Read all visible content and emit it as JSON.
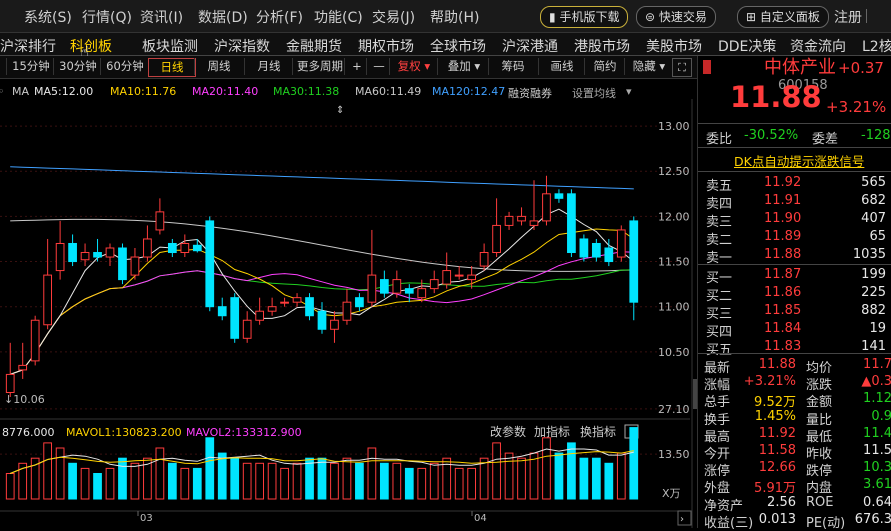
{
  "menubar": {
    "items": [
      "系统(S)",
      "行情(Q)",
      "资讯(I)",
      "数据(D)",
      "分析(F)",
      "功能(C)",
      "交易(J)",
      "帮助(H)"
    ],
    "mobile_download": "手机版下载",
    "quick_trade": "快速交易",
    "custom_panel": "自定义面板",
    "register": "注册"
  },
  "tabs": [
    "沪深排行",
    "科创板",
    "板块监测",
    "沪深指数",
    "金融期货",
    "期权市场",
    "全球市场",
    "沪深港通",
    "港股市场",
    "美股市场",
    "DDE决策",
    "资金流向",
    "L2核"
  ],
  "active_tab": 1,
  "periods": [
    "15分钟",
    "30分钟",
    "60分钟",
    "日线",
    "周线",
    "月线",
    "更多周期",
    "+",
    "—",
    "复权",
    "叠加",
    "筹码",
    "画线",
    "简约",
    "隐藏"
  ],
  "active_period": 3,
  "ma_line": {
    "prefix": "MA",
    "ma5": "MA5:12.00",
    "ma10": "MA10:11.76",
    "ma20": "MA20:11.40",
    "ma30": "MA30:11.38",
    "ma60": "MA60:11.49",
    "ma120": "MA120:12.47",
    "rzrq": "融资融券",
    "settings": "设置均线"
  },
  "price_axis": [
    "13.00",
    "12.50",
    "12.00",
    "11.50",
    "11.00",
    "10.50"
  ],
  "low_label": "10.06",
  "vol_line": {
    "vol": "8776.000",
    "mavol1": "MAVOL1:130823.200",
    "mavol2": "MAVOL2:133312.900",
    "change_params": "改参数",
    "add_indicator": "加指标",
    "switch_indicator": "换指标"
  },
  "vol_axis": [
    "27.10",
    "13.50",
    "X万"
  ],
  "date_labels": [
    "03",
    "04"
  ],
  "colors": {
    "up": "#ff3c3c",
    "down": "#00e5ff",
    "ma5": "#e8e8e8",
    "ma10": "#ffd200",
    "ma20": "#ff40ff",
    "ma30": "#20d020",
    "ma60": "#c8c8c8",
    "ma120": "#40a0ff"
  },
  "chart_data": {
    "type": "candlestick",
    "candles": [
      [
        10.05,
        10.25,
        10.6,
        10.0
      ],
      [
        10.3,
        10.35,
        10.6,
        10.2
      ],
      [
        10.4,
        10.85,
        10.9,
        10.35
      ],
      [
        10.8,
        11.35,
        11.75,
        10.75
      ],
      [
        11.4,
        11.7,
        11.95,
        11.3
      ],
      [
        11.7,
        11.5,
        11.8,
        11.45
      ],
      [
        11.52,
        11.6,
        11.7,
        11.45
      ],
      [
        11.6,
        11.55,
        11.75,
        11.5
      ],
      [
        11.55,
        11.65,
        11.7,
        11.45
      ],
      [
        11.65,
        11.3,
        11.7,
        11.25
      ],
      [
        11.35,
        11.55,
        11.65,
        11.3
      ],
      [
        11.55,
        11.75,
        11.9,
        11.5
      ],
      [
        11.85,
        12.05,
        12.2,
        11.8
      ],
      [
        11.7,
        11.6,
        11.75,
        11.55
      ],
      [
        11.6,
        11.7,
        11.8,
        11.55
      ],
      [
        11.68,
        11.62,
        11.75,
        11.6
      ],
      [
        11.95,
        11.0,
        12.0,
        10.95
      ],
      [
        11.0,
        10.9,
        11.1,
        10.85
      ],
      [
        11.1,
        10.65,
        11.15,
        10.6
      ],
      [
        10.65,
        10.85,
        10.95,
        10.6
      ],
      [
        10.85,
        10.95,
        11.1,
        10.8
      ],
      [
        10.95,
        11.0,
        11.1,
        10.9
      ],
      [
        11.05,
        11.05,
        11.1,
        11.0
      ],
      [
        11.05,
        11.1,
        11.15,
        11.0
      ],
      [
        11.1,
        10.9,
        11.15,
        10.85
      ],
      [
        10.95,
        10.75,
        11.05,
        10.7
      ],
      [
        10.75,
        10.85,
        10.95,
        10.6
      ],
      [
        10.85,
        11.05,
        11.2,
        10.8
      ],
      [
        11.1,
        11.0,
        11.15,
        10.95
      ],
      [
        11.05,
        11.35,
        11.85,
        11.0
      ],
      [
        11.3,
        11.15,
        11.4,
        11.1
      ],
      [
        11.15,
        11.3,
        11.4,
        11.1
      ],
      [
        11.2,
        11.15,
        11.25,
        11.05
      ],
      [
        11.1,
        11.2,
        11.3,
        11.05
      ],
      [
        11.2,
        11.3,
        11.4,
        11.15
      ],
      [
        11.25,
        11.4,
        11.6,
        11.2
      ],
      [
        11.35,
        11.35,
        11.45,
        11.3
      ],
      [
        11.3,
        11.35,
        11.45,
        11.2
      ],
      [
        11.45,
        11.6,
        11.7,
        11.4
      ],
      [
        11.6,
        11.9,
        12.2,
        11.55
      ],
      [
        11.9,
        12.0,
        12.05,
        11.85
      ],
      [
        11.95,
        12.0,
        12.1,
        11.9
      ],
      [
        11.9,
        11.95,
        12.4,
        11.85
      ],
      [
        11.95,
        12.25,
        12.45,
        11.9
      ],
      [
        12.25,
        12.2,
        12.3,
        12.15
      ],
      [
        12.25,
        11.6,
        12.3,
        11.55
      ],
      [
        11.75,
        11.55,
        11.8,
        11.5
      ],
      [
        11.7,
        11.55,
        11.75,
        11.5
      ],
      [
        11.65,
        11.5,
        11.75,
        11.45
      ],
      [
        11.55,
        11.85,
        11.9,
        11.5
      ],
      [
        11.95,
        11.05,
        12.0,
        10.85
      ]
    ],
    "volumes": [
      5,
      7,
      8,
      11,
      10,
      7,
      6,
      5,
      6,
      8,
      7,
      8,
      10,
      7,
      6,
      6,
      12,
      9,
      8,
      7,
      7,
      7,
      6,
      7,
      8,
      8,
      7,
      8,
      7,
      10,
      7,
      7,
      6,
      6,
      7,
      8,
      6,
      6,
      8,
      11,
      9,
      8,
      9,
      12,
      9,
      11,
      8,
      8,
      7,
      9,
      14
    ],
    "ylim": [
      10.0,
      13.3
    ],
    "vol_max": 27.1
  },
  "stock": {
    "name": "中体产业",
    "code": "600158",
    "change": "+0.37",
    "change_pct": "+3.21%",
    "price": "11.88"
  },
  "ratio": {
    "weibi_label": "委比",
    "weibi": "-30.52%",
    "weicha_label": "委差",
    "weicha": "-128"
  },
  "dk_signal": "DK点自动提示涨跌信号",
  "asks": [
    {
      "label": "卖五",
      "price": "11.92",
      "vol": "565"
    },
    {
      "label": "卖四",
      "price": "11.91",
      "vol": "682"
    },
    {
      "label": "卖三",
      "price": "11.90",
      "vol": "407"
    },
    {
      "label": "卖二",
      "price": "11.89",
      "vol": "65"
    },
    {
      "label": "卖一",
      "price": "11.88",
      "vol": "1035"
    }
  ],
  "bids": [
    {
      "label": "买一",
      "price": "11.87",
      "vol": "199"
    },
    {
      "label": "买二",
      "price": "11.86",
      "vol": "225"
    },
    {
      "label": "买三",
      "price": "11.85",
      "vol": "882"
    },
    {
      "label": "买四",
      "price": "11.84",
      "vol": "19"
    },
    {
      "label": "买五",
      "price": "11.83",
      "vol": "141"
    }
  ],
  "stats": [
    {
      "l1": "最新",
      "v1": "11.88",
      "c1": "red",
      "l2": "均价",
      "v2": "11.7",
      "c2": "red"
    },
    {
      "l1": "涨幅",
      "v1": "+3.21%",
      "c1": "red",
      "l2": "涨跌",
      "v2": "▲0.3",
      "c2": "red"
    },
    {
      "l1": "总手",
      "v1": "9.52万",
      "c1": "yellowc",
      "l2": "金额",
      "v2": "1.12",
      "c2": "green"
    },
    {
      "l1": "换手",
      "v1": "1.45%",
      "c1": "yellowc",
      "l2": "量比",
      "v2": "0.9",
      "c2": "green"
    },
    {
      "l1": "最高",
      "v1": "11.92",
      "c1": "red",
      "l2": "最低",
      "v2": "11.4",
      "c2": "green"
    },
    {
      "l1": "今开",
      "v1": "11.58",
      "c1": "red",
      "l2": "昨收",
      "v2": "11.5",
      "c2": "white"
    },
    {
      "l1": "涨停",
      "v1": "12.66",
      "c1": "red",
      "l2": "跌停",
      "v2": "10.3",
      "c2": "green"
    },
    {
      "l1": "外盘",
      "v1": "5.91万",
      "c1": "red",
      "l2": "内盘",
      "v2": "3.61",
      "c2": "green"
    },
    {
      "l1": "净资产",
      "v1": "2.56",
      "c1": "white",
      "l2": "ROE",
      "v2": "0.64",
      "c2": "white"
    },
    {
      "l1": "收益(三)",
      "v1": "0.013",
      "c1": "white",
      "l2": "PE(动)",
      "v2": "676.3",
      "c2": "white"
    }
  ]
}
